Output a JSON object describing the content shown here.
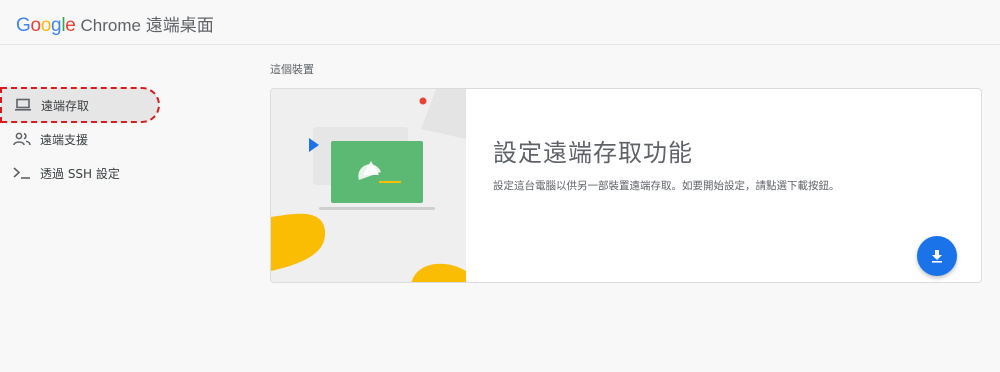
{
  "header": {
    "logo_letters": [
      "G",
      "o",
      "o",
      "g",
      "l",
      "e"
    ],
    "logo_colors": [
      "#4285f4",
      "#ea4335",
      "#fbbc05",
      "#4285f4",
      "#34a853",
      "#ea4335"
    ],
    "app_name": "Chrome 遠端桌面"
  },
  "sidebar": {
    "items": [
      {
        "label": "遠端存取",
        "icon": "laptop-icon",
        "active": true
      },
      {
        "label": "遠端支援",
        "icon": "people-icon",
        "active": false
      },
      {
        "label": "透過 SSH 設定",
        "icon": "terminal-icon",
        "active": false
      }
    ]
  },
  "main": {
    "section_label": "這個裝置",
    "card": {
      "title": "設定遠端存取功能",
      "description": "設定這台電腦以供另一部裝置遠端存取。如要開始設定，請點選下載按鈕。",
      "fab_icon": "download-icon"
    }
  },
  "colors": {
    "accent": "#1a73e8",
    "green": "#5bb974",
    "yellow": "#fbbc04",
    "red": "#ea4335"
  }
}
